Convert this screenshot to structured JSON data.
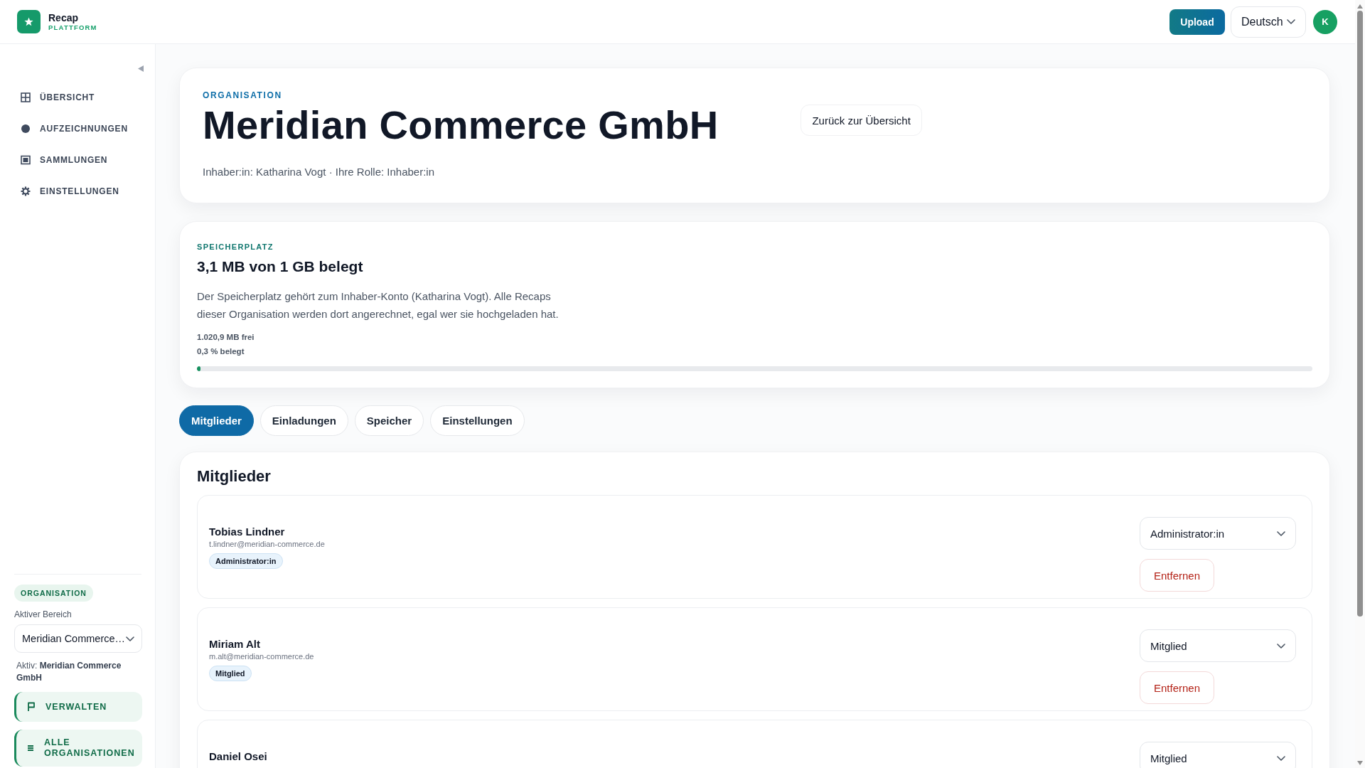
{
  "brand": {
    "name": "Recap",
    "tagline": "PLATTFORM"
  },
  "topbar": {
    "upload": "Upload",
    "language": "Deutsch",
    "avatar": "K"
  },
  "sidebar": {
    "items": [
      {
        "label": "ÜBERSICHT",
        "selected": false
      },
      {
        "label": "AUFZEICHNUNGEN",
        "selected": false
      },
      {
        "label": "SAMMLUNGEN",
        "selected": false
      },
      {
        "label": "EINSTELLUNGEN",
        "selected": false
      }
    ],
    "organisation": {
      "badge": "ORGANISATION",
      "field_label": "Aktiver Bereich",
      "field_value": "Meridian Commerce…",
      "active_note": "Aktiv: **Meridian Commerce GmbH**",
      "actions": [
        "VERWALTEN",
        "ALLE ORGANISATIONEN"
      ]
    }
  },
  "header": {
    "eyebrow": "ORGANISATION",
    "title": "Meridian Commerce GmbH",
    "subtitle": "Inhaber:in: Katharina Vogt · Ihre Rolle: Inhaber:in",
    "back_button": "Zurück zur Übersicht"
  },
  "storage": {
    "eyebrow": "SPEICHERPLATZ",
    "title": "3,1 MB von 1 GB belegt",
    "description": "Der Speicherplatz gehört zum Inhaber-Konto (Katharina Vogt). Alle Recaps dieser Organisation werden dort angerechnet, egal wer sie hochgeladen hat.",
    "free": "1.020,9 MB frei",
    "used": "0,3 % belegt",
    "level": 0.003
  },
  "tabs": [
    {
      "label": "Mitglieder",
      "selected": true
    },
    {
      "label": "Einladungen",
      "selected": false
    },
    {
      "label": "Speicher",
      "selected": false
    },
    {
      "label": "Einstellungen",
      "selected": false
    }
  ],
  "members": {
    "title": "Mitglieder",
    "rows": [
      {
        "name": "Tobias Lindner",
        "email": "t.lindner@meridian-commerce.de",
        "badge": "Administrator:in",
        "role": "Administrator:in",
        "remove": "Entfernen"
      },
      {
        "name": "Miriam Alt",
        "email": "m.alt@meridian-commerce.de",
        "badge": "Mitglied",
        "role": "Mitglied",
        "remove": "Entfernen"
      },
      {
        "name": "Daniel Osei",
        "role": "Mitglied"
      }
    ]
  }
}
